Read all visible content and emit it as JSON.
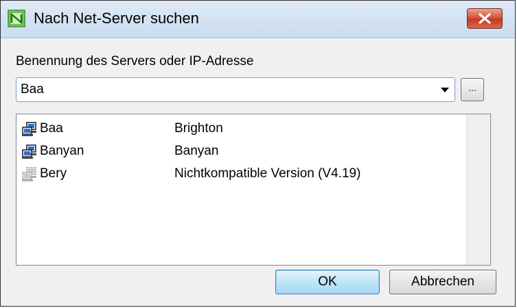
{
  "window": {
    "title": "Nach Net-Server suchen",
    "icon": "net-server-app-icon",
    "close_icon": "close-icon"
  },
  "server_field": {
    "label": "Benennung des Servers oder IP-Adresse",
    "value": "Baa",
    "browse_label": "..."
  },
  "servers": [
    {
      "name": "Baa",
      "description": "Brighton",
      "icon": "server-computer-icon"
    },
    {
      "name": "Banyan",
      "description": "Banyan",
      "icon": "server-computer-icon"
    },
    {
      "name": "Bery",
      "description": "Nichtkompatible Version (V4.19)",
      "icon": "server-incompatible-icon"
    }
  ],
  "buttons": {
    "ok": "OK",
    "cancel": "Abbrechen"
  }
}
